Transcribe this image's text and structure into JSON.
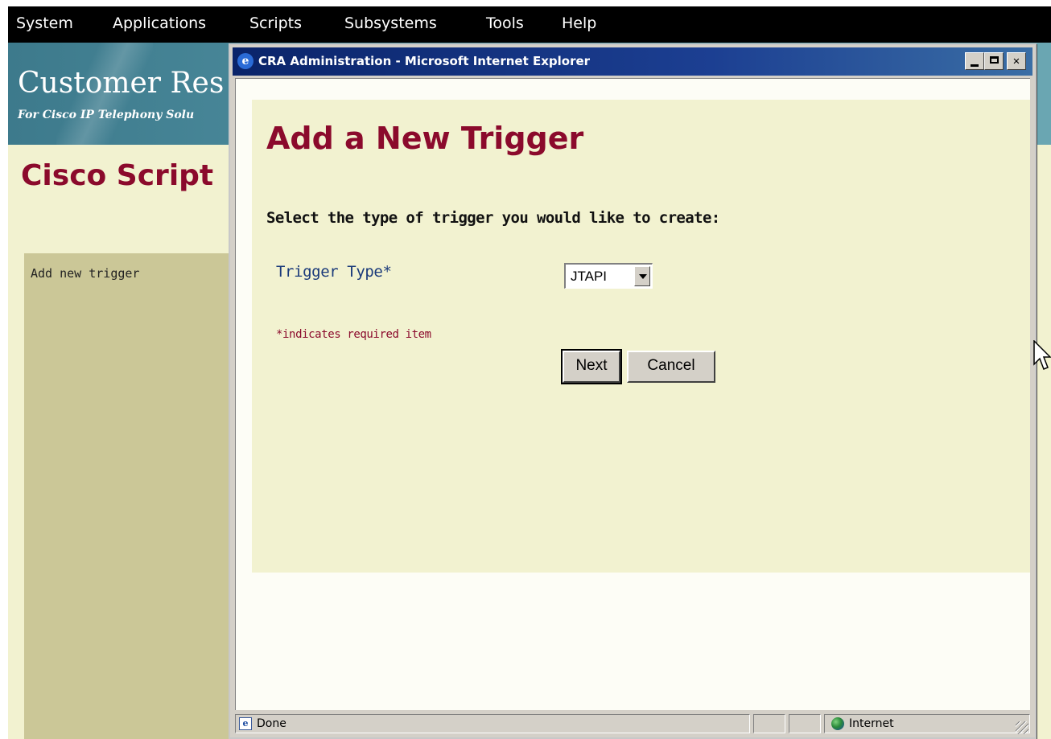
{
  "top_menu": {
    "items": [
      "System",
      "Applications",
      "Scripts",
      "Subsystems",
      "Tools",
      "Help"
    ]
  },
  "banner": {
    "title": "Customer Res",
    "subtitle": "For Cisco IP Telephony Solu"
  },
  "background_page": {
    "heading": "Cisco Script",
    "side_panel_item": "Add new trigger"
  },
  "browser_window": {
    "title": "CRA Administration - Microsoft Internet Explorer",
    "status_text": "Done",
    "zone_text": "Internet"
  },
  "form": {
    "title": "Add a New Trigger",
    "instruction": "Select the type of trigger you would like to create:",
    "trigger_type_label": "Trigger Type*",
    "trigger_type_value": "JTAPI",
    "required_note": "*indicates required item",
    "next_label": "Next",
    "cancel_label": "Cancel"
  },
  "icons": {
    "title_bar": "ie-page-icon",
    "status_page": "ie-page-icon",
    "status_zone": "globe-icon",
    "cursor": "mouse-pointer-icon"
  },
  "colors": {
    "page_background": "#f2f2d0",
    "heading": "#8b0a2c",
    "side_panel": "#cbc797",
    "title_bar": "#0a246a",
    "menu_bar": "#000000",
    "label_text": "#1a3a7a"
  }
}
